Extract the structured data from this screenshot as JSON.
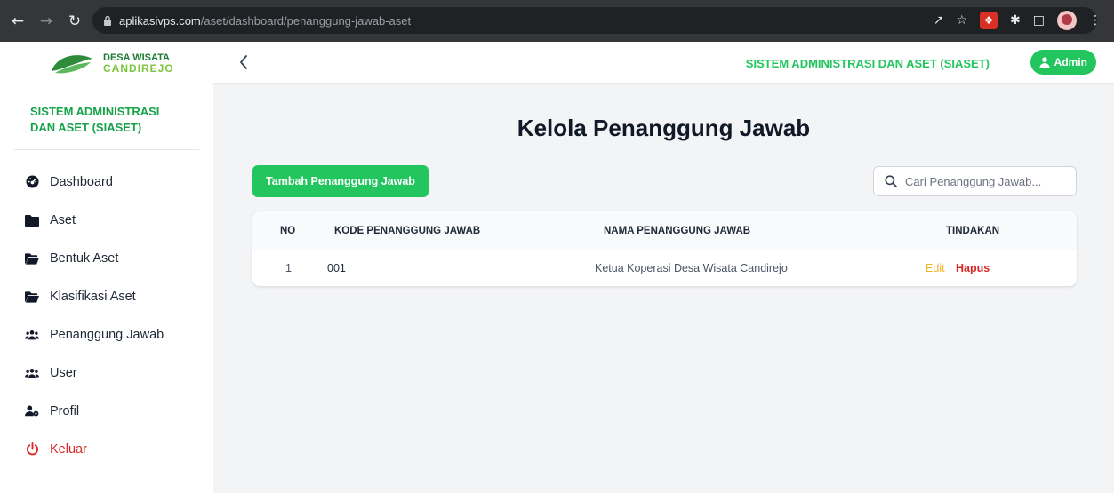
{
  "browser": {
    "url_host": "aplikasivps.com",
    "url_path": "/aset/dashboard/penanggung-jawab-aset"
  },
  "brand": {
    "line1": "DESA WISATA",
    "line2": "CANDIREJO"
  },
  "sidebar": {
    "system_title": "SISTEM ADMINISTRASI DAN ASET (SIASET)",
    "items": [
      {
        "label": "Dashboard",
        "icon": "dashboard-icon"
      },
      {
        "label": "Aset",
        "icon": "folder-icon"
      },
      {
        "label": "Bentuk Aset",
        "icon": "folder-open-icon"
      },
      {
        "label": "Klasifikasi Aset",
        "icon": "folder-open-icon"
      },
      {
        "label": "Penanggung Jawab",
        "icon": "users-icon"
      },
      {
        "label": "User",
        "icon": "users-icon"
      },
      {
        "label": "Profil",
        "icon": "user-gear-icon"
      },
      {
        "label": "Keluar",
        "icon": "power-icon"
      }
    ]
  },
  "topbar": {
    "title": "SISTEM ADMINISTRASI DAN ASET (SIASET)",
    "user_label": "Admin"
  },
  "main": {
    "heading": "Kelola Penanggung Jawab",
    "add_button": "Tambah Penanggung Jawab",
    "search_placeholder": "Cari Penanggung Jawab...",
    "columns": [
      "NO",
      "KODE PENANGGUNG JAWAB",
      "NAMA PENANGGUNG JAWAB",
      "TINDAKAN"
    ],
    "rows": [
      {
        "no": "1",
        "kode": "001",
        "nama": "Ketua Koperasi Desa Wisata Candirejo",
        "edit": "Edit",
        "hapus": "Hapus"
      }
    ]
  },
  "colors": {
    "accent_green": "#22c55e",
    "danger_red": "#dc2626",
    "edit_yellow": "#f0b429"
  }
}
